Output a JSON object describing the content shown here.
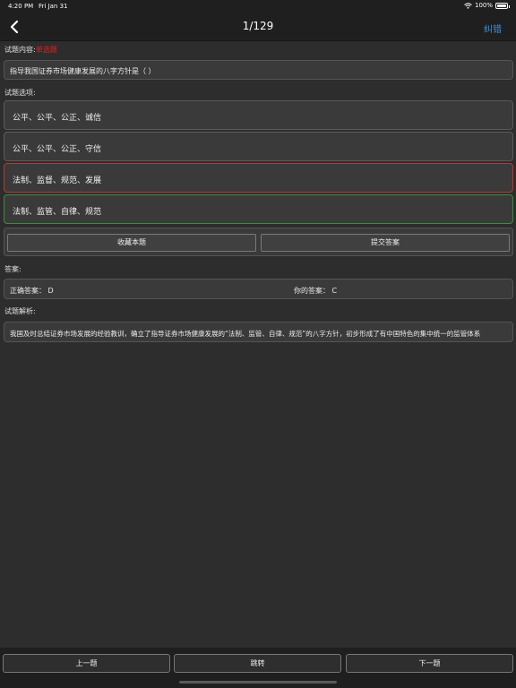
{
  "status_bar": {
    "time": "4:20 PM",
    "date": "Fri Jan 31",
    "battery": "100%"
  },
  "nav": {
    "title": "1/129",
    "report_label": "纠错"
  },
  "question": {
    "section_label": "试题内容:",
    "type_tag": "单选题",
    "text": "指导我国证券市场健康发展的八字方针是（ ）"
  },
  "options": {
    "section_label": "试题选项:",
    "items": [
      {
        "label": "公平、公平、公正、诚信",
        "state": "normal"
      },
      {
        "label": "公平、公平、公正、守信",
        "state": "normal"
      },
      {
        "label": "法制、监督、规范、发展",
        "state": "wrong"
      },
      {
        "label": "法制、监管、自律、规范",
        "state": "correct"
      }
    ]
  },
  "actions": {
    "favorite_label": "收藏本题",
    "submit_label": "提交答案"
  },
  "answer": {
    "section_label": "答案:",
    "correct_label": "正确答案： D",
    "yours_label": "你的答案： C"
  },
  "explanation": {
    "section_label": "试题解析:",
    "text": "我国及时总结证券市场发展的经验教训，确立了指导证券市场健康发展的“法制、监管、自律、规范”的八字方针，初步形成了有中国特色的集中统一的监管体系"
  },
  "bottom": {
    "prev_label": "上一题",
    "jump_label": "跳转",
    "next_label": "下一题"
  },
  "colors": {
    "accent": "#3d8fe0",
    "wrong": "#b23a3a",
    "correct": "#3f8a42",
    "tag": "#e02020"
  }
}
